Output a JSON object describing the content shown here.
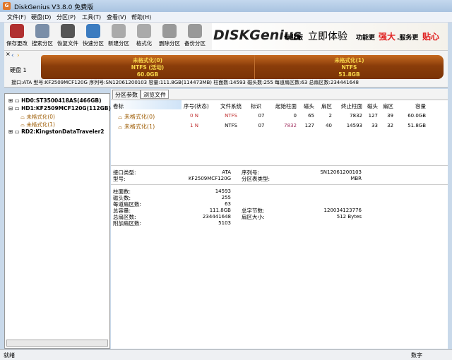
{
  "window": {
    "title": "DiskGenius V3.8.0 免费版",
    "icon": "diskgenius-logo-icon"
  },
  "menu": [
    "文件(F)",
    "硬盘(D)",
    "分区(P)",
    "工具(T)",
    "查看(V)",
    "帮助(H)"
  ],
  "toolbar": [
    {
      "label": "保存更改",
      "icon": "save-icon",
      "color": "#b03030"
    },
    {
      "label": "搜索分区",
      "icon": "search-icon",
      "color": "#7a8ea8"
    },
    {
      "label": "恢复文件",
      "icon": "recover-icon",
      "color": "#555555"
    },
    {
      "label": "快速分区",
      "icon": "quick-partition-icon",
      "color": "#3c7cc0"
    },
    {
      "label": "新建分区",
      "icon": "new-partition-icon",
      "color": "#aaaaaa"
    },
    {
      "label": "格式化",
      "icon": "format-icon",
      "color": "#aaaaaa"
    },
    {
      "label": "删除分区",
      "icon": "delete-icon",
      "color": "#999999"
    },
    {
      "label": "备份分区",
      "icon": "backup-icon",
      "color": "#999999"
    }
  ],
  "banner": {
    "logo": "DISKGenius",
    "edition": "专业版",
    "slogan1": "立即体验",
    "slogan2": "功能更",
    "slogan3": "强大",
    "slogan4": ".服务更",
    "slogan5": "贴心"
  },
  "disk": {
    "label": "硬盘 1",
    "partitions": [
      {
        "name": "未格式化(0)",
        "fs": "NTFS (活动)",
        "size": "60.0GB",
        "share": 0.537
      },
      {
        "name": "未格式化(1)",
        "fs": "NTFS",
        "size": "51.8GB",
        "share": 0.463
      }
    ]
  },
  "infoline": "接口:ATA  型号:KF2509MCF120G  序列号:SN12061200103  容量:111.8GB(114473MB)  柱面数:14593  磁头数:255  每道扇区数:63  总扇区数:234441648",
  "tree": [
    {
      "label": "HD0:ST3500418AS(466GB)",
      "level": 0
    },
    {
      "label": "HD1:KF2509MCF120G(112GB)",
      "level": 0
    },
    {
      "label": "未格式化(0)",
      "level": 1
    },
    {
      "label": "未格式化(1)",
      "level": 1
    },
    {
      "label": "RD2:KingstonDataTraveler2",
      "level": 0
    }
  ],
  "tabs": [
    "分区参数",
    "浏览文件"
  ],
  "table": {
    "headers": [
      "卷标",
      "序号(状态)",
      "文件系统",
      "标识",
      "起始柱面",
      "磁头",
      "扇区",
      "终止柱面",
      "磁头",
      "扇区",
      "容量"
    ],
    "rows": [
      [
        "未格式化(0)",
        "0 N",
        "NTFS",
        "07",
        "0",
        "65",
        "2",
        "7832",
        "127",
        "39",
        "60.0GB"
      ],
      [
        "未格式化(1)",
        "1 N",
        "NTFS",
        "07",
        "7832",
        "127",
        "40",
        "14593",
        "33",
        "32",
        "51.8GB"
      ]
    ]
  },
  "details": {
    "interface_label": "接口类型:",
    "interface": "ATA",
    "serial_label": "序列号:",
    "serial": "SN12061200103",
    "model_label": "型号:",
    "model": "KF2509MCF120G",
    "pt_label": "分区表类型:",
    "pt": "MBR",
    "cyl_label": "柱面数:",
    "cyl": "14593",
    "heads_label": "磁头数:",
    "heads": "255",
    "spt_label": "每道扇区数:",
    "spt": "63",
    "cap_label": "总容量:",
    "cap": "111.8GB",
    "bytes_label": "总字节数:",
    "bytes": "120034123776",
    "sectors_label": "总扇区数:",
    "sectors": "234441648",
    "ssize_label": "扇区大小:",
    "ssize": "512 Bytes",
    "extra_label": "附加扇区数:",
    "extra": "5103"
  },
  "status": {
    "left": "就绪",
    "right": "数字"
  }
}
